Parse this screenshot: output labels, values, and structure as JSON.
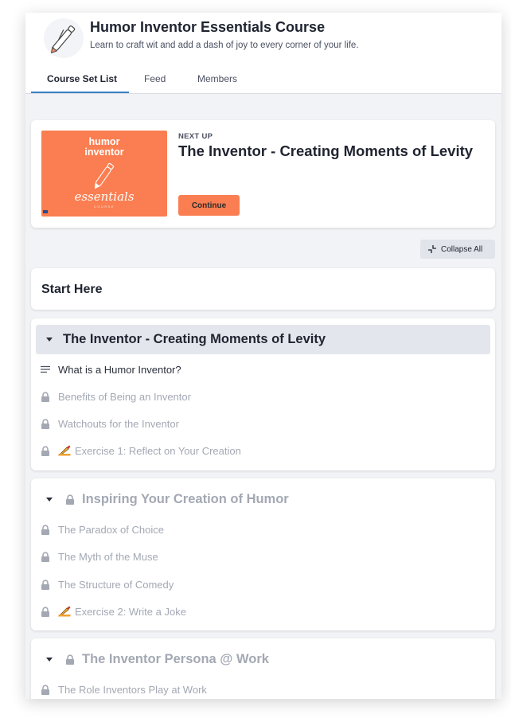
{
  "header": {
    "title": "Humor Inventor Essentials Course",
    "subtitle": "Learn to craft wit and add a dash of joy to every corner of your life.",
    "tabs": [
      {
        "label": "Course Set List",
        "active": true
      },
      {
        "label": "Feed",
        "active": false
      },
      {
        "label": "Members",
        "active": false
      }
    ]
  },
  "next_up": {
    "label": "NEXT UP",
    "title": "The Inventor - Creating Moments of Levity",
    "button_label": "Continue",
    "thumbnail": {
      "line1": "humor",
      "line2": "inventor",
      "script": "essentials",
      "small": "COURSE"
    }
  },
  "collapse_all_label": "Collapse All",
  "start_here": "Start Here",
  "sections": [
    {
      "title": "The Inventor - Creating Moments of Levity",
      "locked": false,
      "items": [
        {
          "label": "What is a Humor Inventor?",
          "locked": false,
          "icon": "text-lines-icon"
        },
        {
          "label": "Benefits of Being an Inventor",
          "locked": true,
          "icon": "lock-icon"
        },
        {
          "label": "Watchouts for the Inventor",
          "locked": true,
          "icon": "lock-icon"
        },
        {
          "label": "Exercise 1: Reflect on Your Creation",
          "locked": true,
          "icon": "lock-icon",
          "emoji": "writing-hand-icon"
        }
      ]
    },
    {
      "title": "Inspiring Your Creation of Humor",
      "locked": true,
      "items": [
        {
          "label": "The Paradox of Choice",
          "locked": true,
          "icon": "lock-icon"
        },
        {
          "label": "The Myth of the Muse",
          "locked": true,
          "icon": "lock-icon"
        },
        {
          "label": "The Structure of Comedy",
          "locked": true,
          "icon": "lock-icon"
        },
        {
          "label": "Exercise 2: Write a Joke",
          "locked": true,
          "icon": "lock-icon",
          "emoji": "writing-hand-icon"
        }
      ]
    },
    {
      "title": "The Inventor Persona @ Work",
      "locked": true,
      "items": [
        {
          "label": "The Role Inventors Play at Work",
          "locked": true,
          "icon": "lock-icon"
        }
      ]
    }
  ],
  "colors": {
    "accent_orange": "#fa7e51",
    "tab_underline": "#3b82c4",
    "muted_text": "#a3a8b3"
  }
}
